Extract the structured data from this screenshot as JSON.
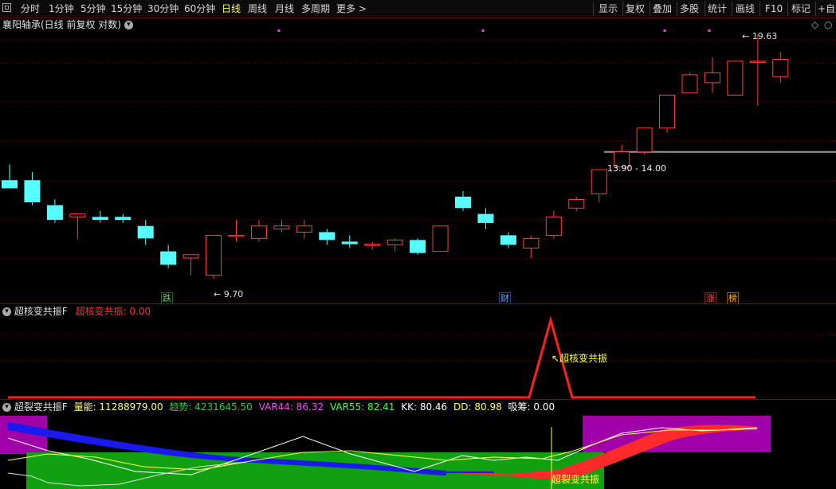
{
  "toolbar": {
    "left_items": [
      "分时",
      "1分钟",
      "5分钟",
      "15分钟",
      "30分钟",
      "60分钟",
      "日线",
      "周线",
      "月线",
      "多周期",
      "更多 >"
    ],
    "active_index": 6,
    "right_items": [
      "显示",
      "复权",
      "叠加",
      "多股",
      "统计",
      "画线",
      "F10",
      "标记",
      "+自选"
    ]
  },
  "main_panel": {
    "title": "襄阳轴承(日线 前复权 对数)",
    "price_high_label": "19.63",
    "price_low_label": "9.70",
    "range_label": "13.90 - 14.00",
    "markers": [
      {
        "text": "跌",
        "color": "#55dd55"
      },
      {
        "text": "财",
        "color": "#55aaff"
      },
      {
        "text": "涨",
        "color": "#ff5555"
      },
      {
        "text": "榜",
        "color": "#ffaa33"
      }
    ],
    "candles": [
      {
        "o": 12.9,
        "h": 13.5,
        "l": 12.7,
        "c": 12.6
      },
      {
        "o": 12.9,
        "h": 13.2,
        "l": 12.0,
        "c": 12.1
      },
      {
        "o": 12.0,
        "h": 12.2,
        "l": 11.4,
        "c": 11.5
      },
      {
        "o": 11.6,
        "h": 11.7,
        "l": 10.9,
        "c": 11.7
      },
      {
        "o": 11.6,
        "h": 11.8,
        "l": 11.4,
        "c": 11.5
      },
      {
        "o": 11.6,
        "h": 11.7,
        "l": 11.4,
        "c": 11.5
      },
      {
        "o": 11.3,
        "h": 11.5,
        "l": 10.7,
        "c": 10.9
      },
      {
        "o": 10.5,
        "h": 10.7,
        "l": 10.0,
        "c": 10.1
      },
      {
        "o": 10.3,
        "h": 10.4,
        "l": 9.8,
        "c": 10.4
      },
      {
        "o": 9.8,
        "h": 11.0,
        "l": 9.7,
        "c": 11.0
      },
      {
        "o": 11.0,
        "h": 11.5,
        "l": 10.8,
        "c": 11.0
      },
      {
        "o": 10.9,
        "h": 11.5,
        "l": 10.8,
        "c": 11.3
      },
      {
        "o": 11.2,
        "h": 11.5,
        "l": 11.1,
        "c": 11.3
      },
      {
        "o": 11.1,
        "h": 11.5,
        "l": 10.9,
        "c": 11.3
      },
      {
        "o": 11.1,
        "h": 11.2,
        "l": 10.7,
        "c": 10.85
      },
      {
        "o": 10.8,
        "h": 11.0,
        "l": 10.6,
        "c": 10.72
      },
      {
        "o": 10.68,
        "h": 10.8,
        "l": 10.55,
        "c": 10.72
      },
      {
        "o": 10.7,
        "h": 10.9,
        "l": 10.5,
        "c": 10.85
      },
      {
        "o": 10.85,
        "h": 10.9,
        "l": 10.4,
        "c": 10.45
      },
      {
        "o": 10.5,
        "h": 11.3,
        "l": 10.5,
        "c": 11.3
      },
      {
        "o": 12.3,
        "h": 12.5,
        "l": 11.8,
        "c": 11.9
      },
      {
        "o": 11.7,
        "h": 11.9,
        "l": 11.2,
        "c": 11.4
      },
      {
        "o": 11.0,
        "h": 11.1,
        "l": 10.6,
        "c": 10.7
      },
      {
        "o": 10.6,
        "h": 11.0,
        "l": 10.3,
        "c": 10.9
      },
      {
        "o": 11.0,
        "h": 11.8,
        "l": 10.9,
        "c": 11.6
      },
      {
        "o": 11.9,
        "h": 12.3,
        "l": 11.8,
        "c": 12.2
      },
      {
        "o": 12.4,
        "h": 13.3,
        "l": 12.1,
        "c": 13.3
      },
      {
        "o": 13.4,
        "h": 14.3,
        "l": 13.4,
        "c": 14.0
      },
      {
        "o": 14.0,
        "h": 15.0,
        "l": 13.9,
        "c": 15.0
      },
      {
        "o": 15.0,
        "h": 16.5,
        "l": 14.8,
        "c": 16.5
      },
      {
        "o": 16.6,
        "h": 17.6,
        "l": 16.6,
        "c": 17.5
      },
      {
        "o": 17.1,
        "h": 18.4,
        "l": 16.6,
        "c": 17.6
      },
      {
        "o": 16.5,
        "h": 18.2,
        "l": 16.5,
        "c": 18.2
      },
      {
        "o": 18.2,
        "h": 19.63,
        "l": 16.0,
        "c": 18.2
      },
      {
        "o": 17.4,
        "h": 18.7,
        "l": 17.1,
        "c": 18.3
      }
    ]
  },
  "panel2": {
    "title": "超核变共振F",
    "value_label": "超核变共振: 0.00",
    "annotation": "超核变共振",
    "line_color": "#ff2020"
  },
  "panel3": {
    "title": "超裂变共振F",
    "indicators": [
      {
        "text": "量能: 11288979.00",
        "color": "#ffff66"
      },
      {
        "text": "趋势: 4231645.50",
        "color": "#33cc33"
      },
      {
        "text": "VAR44: 86.32",
        "color": "#ff44ff"
      },
      {
        "text": "VAR55: 82.41",
        "color": "#44ff44"
      },
      {
        "text": "KK: 80.46",
        "color": "#ffffff"
      },
      {
        "text": "DD: 80.98",
        "color": "#ffff44"
      },
      {
        "text": "吸筹: 0.00",
        "color": "#ffffff"
      }
    ],
    "annotation": "超裂变共振"
  },
  "colors": {
    "up": "#ff4040",
    "down": "#55ffff",
    "grid": "#6a0000",
    "divider": "#8a0000",
    "magenta_dot": "#ff33ff"
  }
}
